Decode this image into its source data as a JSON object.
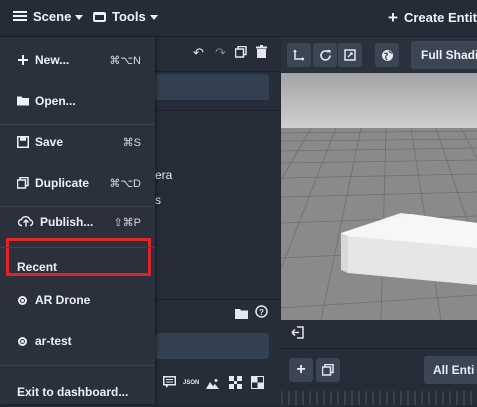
{
  "topbar": {
    "scene_label": "Scene",
    "tools_label": "Tools",
    "create_label": "Create Entit"
  },
  "menu": {
    "items": [
      {
        "label": "New...",
        "shortcut": "⌘⌥N"
      },
      {
        "label": "Open...",
        "shortcut": ""
      },
      {
        "label": "Save",
        "shortcut": "⌘S"
      },
      {
        "label": "Duplicate",
        "shortcut": "⌘⌥D"
      },
      {
        "label": "Publish...",
        "shortcut": "⇧⌘P"
      }
    ],
    "recent_heading": "Recent",
    "recent_items": [
      {
        "label": "AR Drone"
      },
      {
        "label": "ar-test"
      }
    ],
    "exit_label": "Exit to dashboard..."
  },
  "hierarchy": {
    "partial_item_1": "era",
    "partial_item_2": "s"
  },
  "viewport": {
    "shading_label": "Full Shadi",
    "entities_filter_label": "All Enti"
  },
  "bottom_tools": {
    "json_label": "JSON"
  },
  "colors": {
    "highlight": "#e0242b",
    "menu_bg": "#2a313d"
  }
}
